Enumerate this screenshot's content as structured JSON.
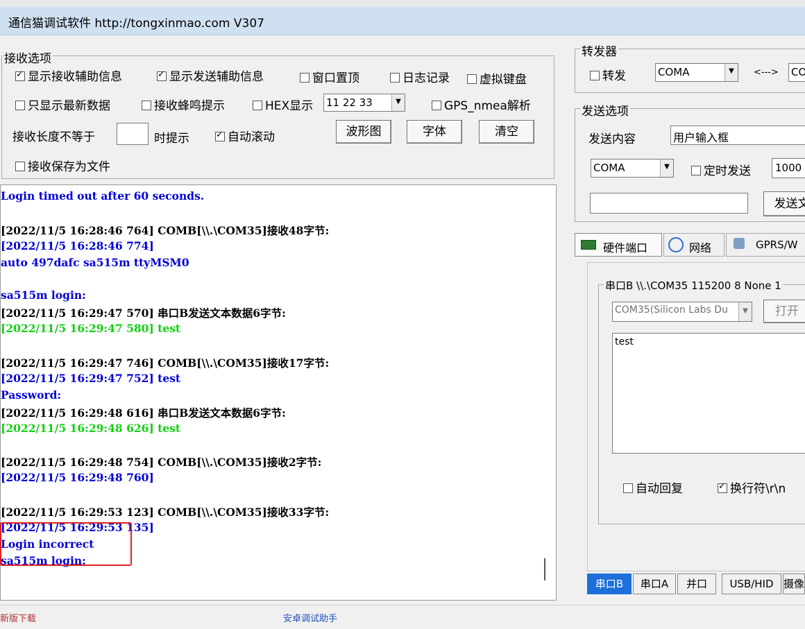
{
  "window": {
    "title": "通信猫调试软件  http://tongxinmao.com  V307"
  },
  "receive_options": {
    "legend": "接收选项",
    "show_recv_info": {
      "label": "显示接收辅助信息",
      "checked": true
    },
    "show_send_info": {
      "label": "显示发送辅助信息",
      "checked": true
    },
    "window_top": {
      "label": "窗口置顶",
      "checked": false
    },
    "log_record": {
      "label": "日志记录",
      "checked": false
    },
    "virtual_keyboard": {
      "label": "虚拟键盘",
      "checked": false
    },
    "show_latest": {
      "label": "只显示最新数据",
      "checked": false
    },
    "recv_beep": {
      "label": "接收蜂鸣提示",
      "checked": false
    },
    "hex_display": {
      "label": "HEX显示",
      "checked": false
    },
    "hex_value": "11 22 33",
    "gps_parse": {
      "label": "GPS_nmea解析",
      "checked": false
    },
    "length_prefix": "接收长度不等于",
    "length_suffix": "时提示",
    "auto_scroll": {
      "label": "自动滚动",
      "checked": true
    },
    "waveform_button": "波形图",
    "font_button": "字体",
    "clear_button": "清空",
    "save_to_file": {
      "label": "接收保存为文件",
      "checked": false
    }
  },
  "forwarder": {
    "legend": "转发器",
    "forward": {
      "label": "转发",
      "checked": false
    },
    "port_a": "COMA",
    "arrow": "<--->",
    "port_b": "CO"
  },
  "send_options": {
    "legend": "发送选项",
    "content_label": "发送内容",
    "content_value": "用户输入框",
    "port": "COMA",
    "timed_send": {
      "label": "定时发送",
      "checked": false
    },
    "interval": "1000",
    "send_button": "发送文"
  },
  "tabs": {
    "hardware": "硬件端口",
    "network": "网络",
    "gprs": "GPRS/W"
  },
  "serial": {
    "legend": "串口B \\\\.\\COM35 115200 8  None  1",
    "device": "COM35(Silicon Labs Du",
    "open_button": "打开",
    "text": "test",
    "auto_reply": {
      "label": "自动回复",
      "checked": false
    },
    "newline": {
      "label": "换行符\\r\\n",
      "checked": true
    }
  },
  "bottom_tabs": [
    "串口B",
    "串口A",
    "并口",
    "USB/HID",
    "摄像"
  ],
  "log_lines": [
    {
      "text": "Login timed out after 60 seconds.",
      "color": "blue"
    },
    {
      "text": "",
      "color": "black"
    },
    {
      "text": "[2022/11/5 16:28:46 764]  COMB[\\\\.\\COM35]接收48字节:",
      "color": "black"
    },
    {
      "text": "[2022/11/5 16:28:46 774]",
      "color": "blue"
    },
    {
      "text": "auto 497dafc sa515m ttyMSM0",
      "color": "blue"
    },
    {
      "text": "",
      "color": "black"
    },
    {
      "text": "sa515m login:",
      "color": "blue"
    },
    {
      "text": "[2022/11/5 16:29:47 570]  串口B发送文本数据6字节:",
      "color": "black"
    },
    {
      "text": "[2022/11/5 16:29:47 580]  test",
      "color": "green"
    },
    {
      "text": "",
      "color": "black"
    },
    {
      "text": "[2022/11/5 16:29:47 746]  COMB[\\\\.\\COM35]接收17字节:",
      "color": "black"
    },
    {
      "text": "[2022/11/5 16:29:47 752]  test",
      "color": "blue"
    },
    {
      "text": "Password:",
      "color": "blue"
    },
    {
      "text": "[2022/11/5 16:29:48 616]  串口B发送文本数据6字节:",
      "color": "black"
    },
    {
      "text": "[2022/11/5 16:29:48 626]  test",
      "color": "green"
    },
    {
      "text": "",
      "color": "black"
    },
    {
      "text": "[2022/11/5 16:29:48 754]  COMB[\\\\.\\COM35]接收2字节:",
      "color": "black"
    },
    {
      "text": "[2022/11/5 16:29:48 760]",
      "color": "blue"
    },
    {
      "text": "",
      "color": "black"
    },
    {
      "text": "[2022/11/5 16:29:53 123]  COMB[\\\\.\\COM35]接收33字节:",
      "color": "black"
    },
    {
      "text": "[2022/11/5 16:29:53 135]",
      "color": "blue"
    },
    {
      "text": "Login incorrect",
      "color": "blue"
    },
    {
      "text": "sa515m login:",
      "color": "blue"
    }
  ],
  "status": {
    "left": "新版下载",
    "center": "安卓调试助手"
  },
  "colors": {
    "titlebar": "#cfe0f1",
    "highlight_box": "#e02020",
    "active_tab": "#1e6fd9"
  }
}
